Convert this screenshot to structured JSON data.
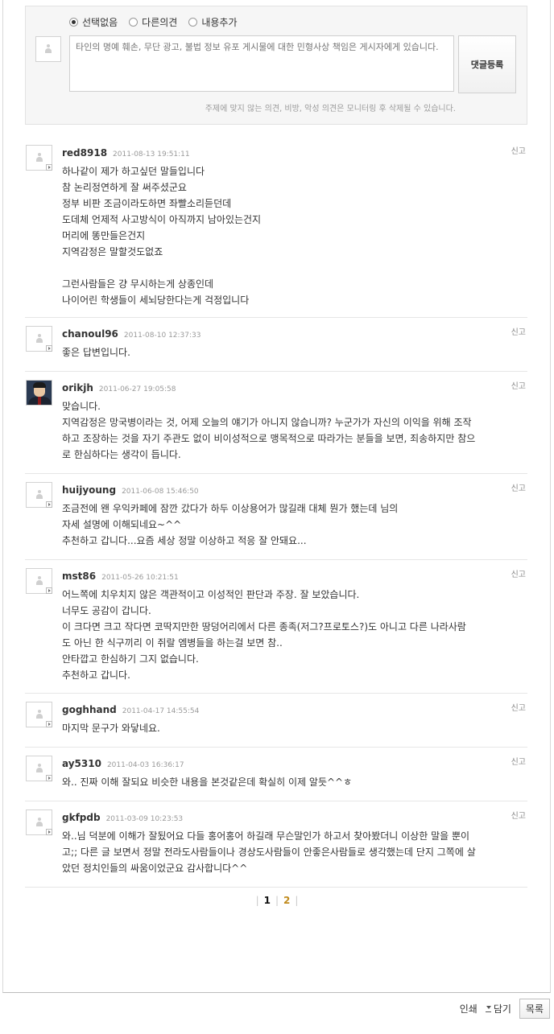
{
  "form": {
    "options": [
      "선택없음",
      "다른의견",
      "내용추가"
    ],
    "selected_index": 0,
    "placeholder": "타인의 명예 훼손, 무단 광고, 불법 정보 유포 게시물에 대한 민형사상 책임은 게시자에게 있습니다.",
    "submit_label": "댓글등록",
    "notice": "주제에 맞지 않는 의견, 비방, 악성 의견은 모니터링 후 삭제될 수 있습니다."
  },
  "report_label": "신고",
  "comments": [
    {
      "nick": "red8918",
      "date": "2011-08-13 19:51:11",
      "lines": [
        "하나같이 제가 하고싶던 말들입니다",
        "참 논리정연하게 잘 써주셨군요",
        "정부 비판 조금이라도하면 좌빨소리듣던데",
        "도데체 언제적 사고방식이 아직까지 남아있는건지",
        "머리에 똥만들은건지",
        "지역감정은 말할것도없죠",
        "",
        "그런사람들은 걍 무시하는게 상종인데",
        "나이어린 학생들이 세뇌당한다는게 걱정입니다"
      ]
    },
    {
      "nick": "chanoul96",
      "date": "2011-08-10 12:37:33",
      "lines": [
        "좋은 답변입니다."
      ]
    },
    {
      "nick": "orikjh",
      "date": "2011-06-27 19:05:58",
      "lines": [
        "맞습니다.",
        "지역감정은 망국병이라는 것, 어제 오늘의 얘기가 아니지 않습니까? 누군가가 자신의 이익을 위해 조작",
        "하고 조장하는 것을 자기 주관도 없이 비이성적으로 맹목적으로 따라가는 분들을 보면, 죄송하지만 참으",
        "로 한심하다는 생각이 듭니다."
      ]
    },
    {
      "nick": "huijyoung",
      "date": "2011-06-08 15:46:50",
      "lines": [
        "조금전에 왠 우익카페에 잠깐 갔다가 하두 이상용어가 많길래 대체 뭔가 했는데 님의",
        "자세 설명에 이해되네요~^^",
        "추천하고 갑니다...요즘 세상 정말 이상하고 적응 잘 안돼요..."
      ]
    },
    {
      "nick": "mst86",
      "date": "2011-05-26 10:21:51",
      "lines": [
        "어느쪽에 치우치지 않은 객관적이고 이성적인 판단과 주장. 잘 보았습니다.",
        "너무도 공감이 갑니다.",
        "이 크다면 크고 작다면 코딱지만한 땅덩어리에서 다른 종족(저그?프로토스?)도 아니고 다른 나라사람",
        "도 아닌 한 식구끼리 이 쥐랄 엠병들을 하는걸 보면 참..",
        "안타깝고 한심하기 그지 없습니다.",
        "추천하고 갑니다."
      ]
    },
    {
      "nick": "goghhand",
      "date": "2011-04-17 14:55:54",
      "lines": [
        "마지막 문구가 와닿네요."
      ]
    },
    {
      "nick": "ay5310",
      "date": "2011-04-03 16:36:17",
      "lines": [
        "와.. 진짜 이해 잘되요 비슷한 내용을 본것같은데 확실히 이제 알듯^^ㅎ"
      ]
    },
    {
      "nick": "gkfpdb",
      "date": "2011-03-09 10:23:53",
      "lines": [
        "와..님 덕분에 이해가 잘됬어요 다들 홍어홍어 하길래 무슨말인가 하고서 찾아봤더니 이상한 말을 뿐이",
        "고;; 다른 글 보면서 정말 전라도사람들이나 경상도사람들이 안좋은사람들로 생각했는데 단지 그쪽에 살",
        "았던 정치인들의 싸움이었군요 감사합니다^^"
      ]
    }
  ],
  "pagination": {
    "pages": [
      "1",
      "2"
    ],
    "current": "1"
  },
  "footer": {
    "print_label": "인쇄",
    "save_label": "담기",
    "list_label": "목록"
  }
}
